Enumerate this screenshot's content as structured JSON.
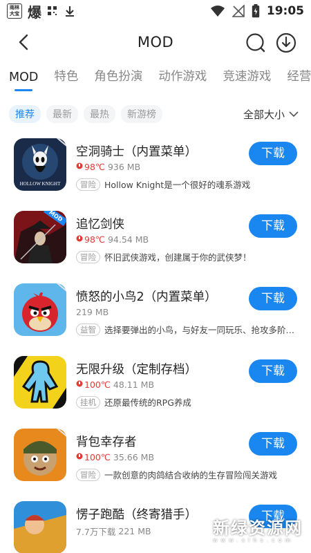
{
  "status_bar": {
    "badge_text": "雨林\n大宝",
    "boom_glyph": "爆",
    "time": "19:05"
  },
  "header": {
    "title": "MOD"
  },
  "tabs": [
    "MOD",
    "特色",
    "角色扮演",
    "动作游戏",
    "竞速游戏",
    "经营"
  ],
  "filters": {
    "chips": [
      "推荐",
      "最新",
      "最热",
      "新游榜"
    ],
    "size_select": "全部大小"
  },
  "download_label": "下载",
  "games": [
    {
      "name": "空洞骑士（内置菜单）",
      "temp": "98℃",
      "size": "936 MB",
      "tag": "冒险",
      "desc": "Hollow Knight是一个很好的魂系游戏"
    },
    {
      "name": "追忆剑侠",
      "temp": "98℃",
      "size": "94.54 MB",
      "tag": "冒险",
      "desc": "怀旧武侠游戏，创建属于你的武侠梦！"
    },
    {
      "name": "愤怒的小鸟2（内置菜单）",
      "temp": "",
      "size": "219 MB",
      "tag": "益智",
      "desc": "选择要弹出的小鸟，与好友一同玩乐、抢攻多阶…"
    },
    {
      "name": "无限升级（定制存档）",
      "temp": "100℃",
      "size": "48.11 MB",
      "tag": "挂机",
      "desc": "还原最传统的RPG养成"
    },
    {
      "name": "背包幸存者",
      "temp": "100℃",
      "size": "35.66 MB",
      "tag": "冒险",
      "desc": "一款创意的肉鸽结合收纳的生存冒险闯关游戏"
    },
    {
      "name": "愣子跑酷（终寄猎手）",
      "downloads": "7.7万下载",
      "size": "221 MB"
    }
  ],
  "icon_text": {
    "hollow_knight": "HOLLOW KNIGHT",
    "mod_badge": "MOD"
  },
  "watermark": {
    "text": "新绿资源网",
    "sub": "www.xlhs.com"
  },
  "colors": {
    "accent": "#1d86f0",
    "temp_red": "#e53935"
  }
}
